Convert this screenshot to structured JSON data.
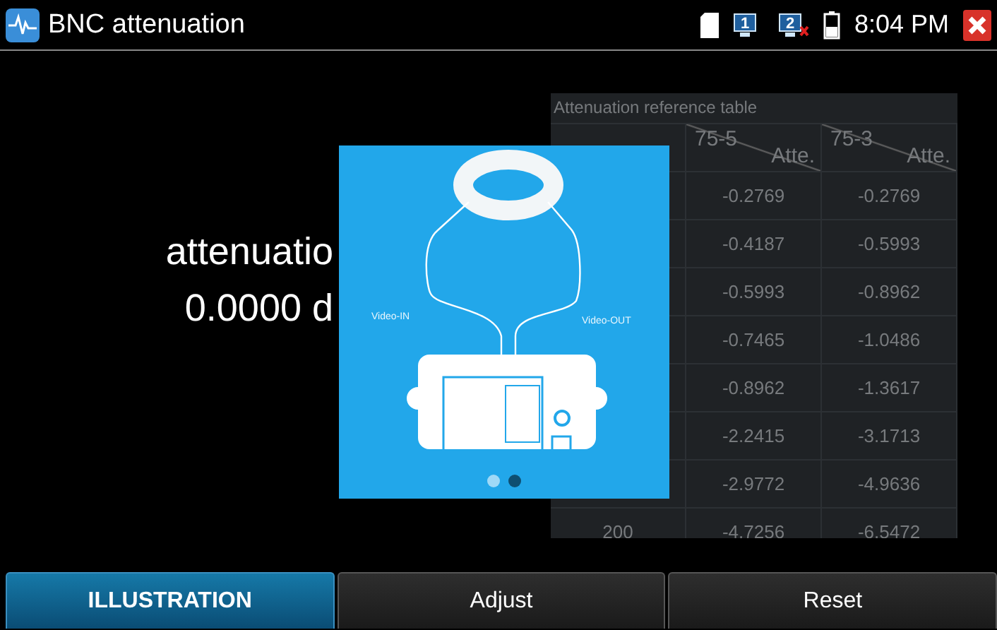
{
  "window": {
    "title": "BNC attenuation",
    "time": "8:04 PM"
  },
  "status_icons": [
    {
      "kind": "sd"
    },
    {
      "kind": "monitor",
      "label": "1",
      "error": false
    },
    {
      "kind": "monitor",
      "label": "2",
      "error": true
    },
    {
      "kind": "battery"
    }
  ],
  "result": {
    "label": "attenuatio",
    "value": "0.0000 d"
  },
  "reference_table": {
    "title": "Attenuation reference table",
    "columns": [
      {
        "name": "75-5",
        "unit": "Atte."
      },
      {
        "name": "75-3",
        "unit": "Atte."
      }
    ],
    "rows": [
      {
        "values": [
          "-0.2769",
          "-0.2769"
        ]
      },
      {
        "values": [
          "-0.4187",
          "-0.5993"
        ]
      },
      {
        "values": [
          "-0.5993",
          "-0.8962"
        ]
      },
      {
        "values": [
          "-0.7465",
          "-1.0486"
        ]
      },
      {
        "values": [
          "-0.8962",
          "-1.3617"
        ]
      },
      {
        "values": [
          "-2.2415",
          "-3.1713"
        ]
      },
      {
        "values": [
          "-2.9772",
          "-4.9636"
        ]
      },
      {
        "length": "200",
        "values": [
          "-4.7256",
          "-6.5472"
        ]
      }
    ]
  },
  "illustration": {
    "labels": [
      "Video-IN",
      "Video-OUT"
    ],
    "pages": [
      {
        "selected": false
      },
      {
        "selected": true
      }
    ]
  },
  "buttons": [
    {
      "label": "ILLUSTRATION",
      "selected": true
    },
    {
      "label": "Adjust",
      "selected": false
    },
    {
      "label": "Reset",
      "selected": false
    }
  ]
}
